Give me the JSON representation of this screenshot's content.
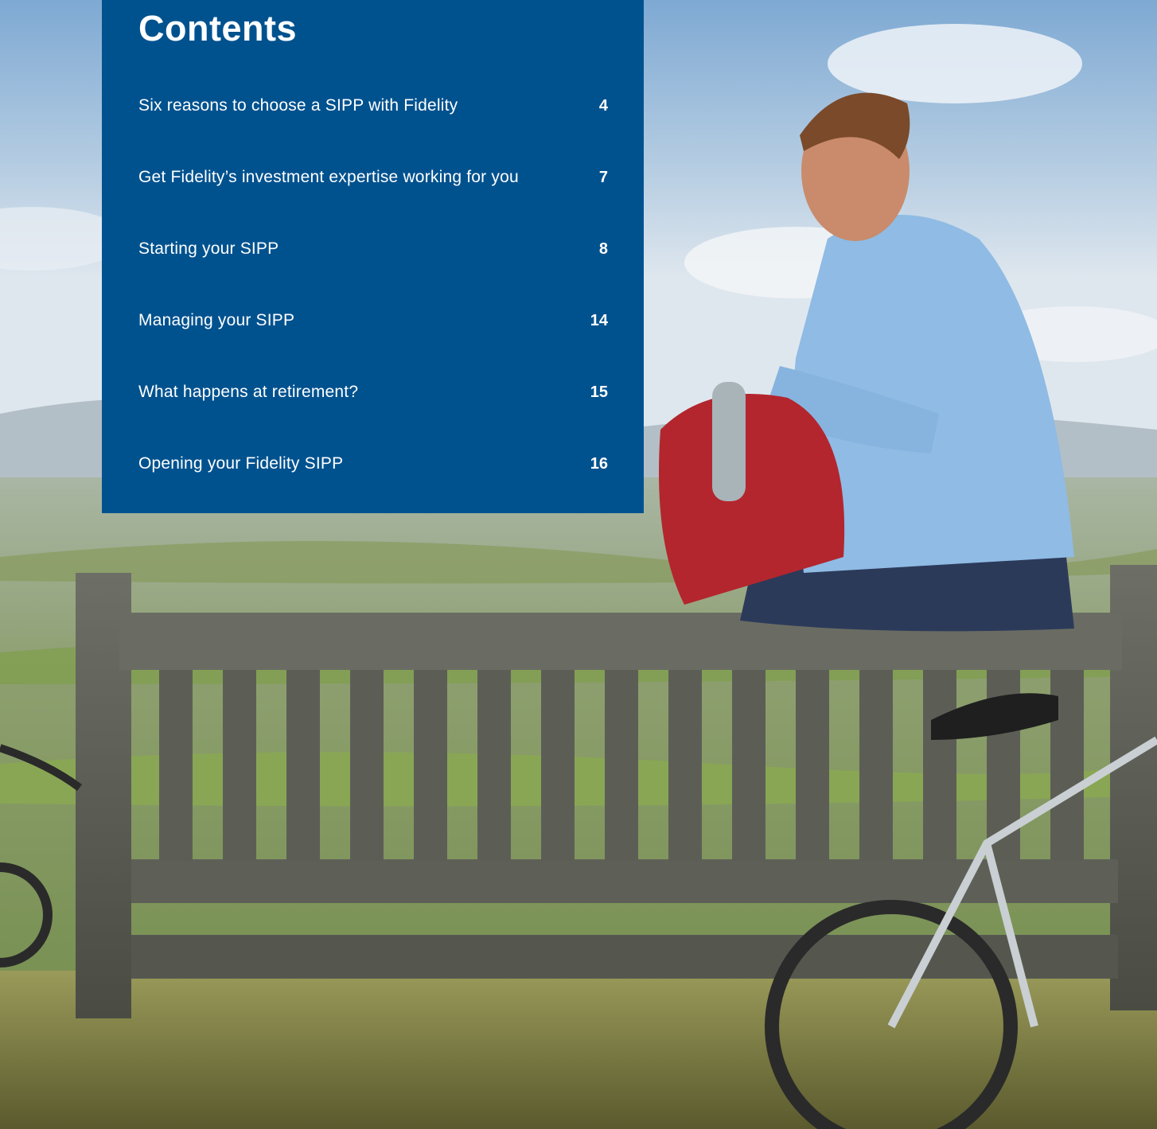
{
  "contents": {
    "title": "Contents",
    "items": [
      {
        "label": "Six reasons to choose a SIPP with Fidelity",
        "page": "4"
      },
      {
        "label": "Get Fidelity’s investment expertise working for you",
        "page": "7"
      },
      {
        "label": "Starting your SIPP",
        "page": "8"
      },
      {
        "label": "Managing your SIPP",
        "page": "14"
      },
      {
        "label": "What happens at retirement?",
        "page": "15"
      },
      {
        "label": "Opening your Fidelity SIPP",
        "page": "16"
      }
    ]
  },
  "colors": {
    "panel": "#00528f",
    "text": "#ffffff"
  }
}
